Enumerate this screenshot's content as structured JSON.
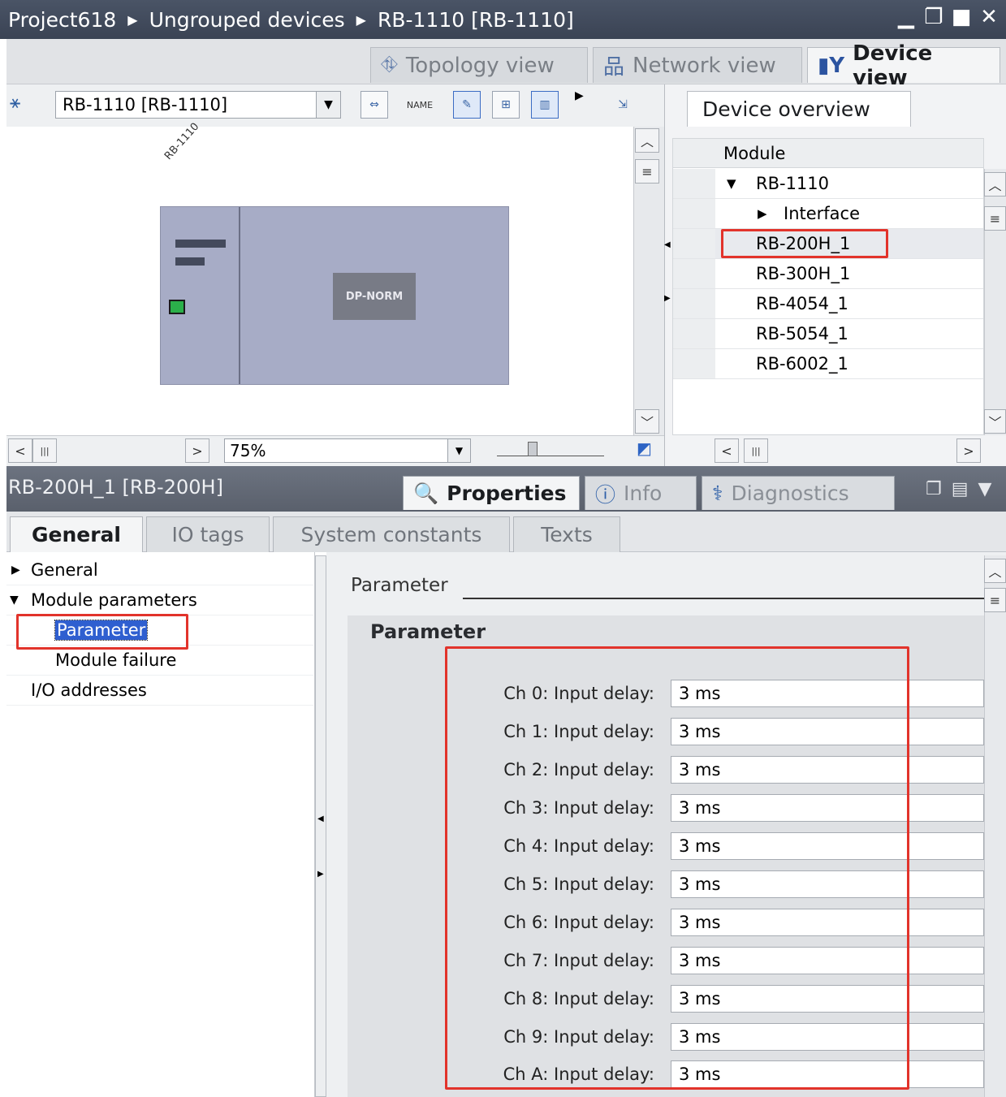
{
  "breadcrumb": [
    "Project618",
    "Ungrouped devices",
    "RB-1110 [RB-1110]"
  ],
  "view_tabs": [
    {
      "label": "Topology view",
      "active": false
    },
    {
      "label": "Network view",
      "active": false
    },
    {
      "label": "Device view",
      "active": true
    }
  ],
  "toolbar": {
    "device_select": "RB-1110 [RB-1110]",
    "zoom": "75%"
  },
  "device": {
    "rack_label": "RB-1110",
    "module_label": "DP-NORM"
  },
  "overview": {
    "tab": "Device overview",
    "column_header": "Module",
    "rows": [
      "RB-1110",
      "Interface",
      "RB-200H_1",
      "RB-300H_1",
      "RB-4054_1",
      "RB-5054_1",
      "RB-6002_1"
    ],
    "selected": "RB-200H_1"
  },
  "properties": {
    "title": "RB-200H_1 [RB-200H]",
    "tabs": [
      "Properties",
      "Info",
      "Diagnostics"
    ],
    "subtabs": [
      "General",
      "IO tags",
      "System constants",
      "Texts"
    ]
  },
  "nav": {
    "items": [
      "General",
      "Module parameters",
      "Parameter",
      "Module failure",
      "I/O addresses"
    ],
    "selected": "Parameter"
  },
  "params": {
    "heading": "Parameter",
    "group_title": "Parameter",
    "rows": [
      {
        "label": "Ch 0: Input delay:",
        "value": "3 ms"
      },
      {
        "label": "Ch 1: Input delay:",
        "value": "3 ms"
      },
      {
        "label": "Ch 2: Input delay:",
        "value": "3 ms"
      },
      {
        "label": "Ch 3: Input delay:",
        "value": "3 ms"
      },
      {
        "label": "Ch 4: Input delay:",
        "value": "3 ms"
      },
      {
        "label": "Ch 5: Input delay:",
        "value": "3 ms"
      },
      {
        "label": "Ch 6: Input delay:",
        "value": "3 ms"
      },
      {
        "label": "Ch 7: Input delay:",
        "value": "3 ms"
      },
      {
        "label": "Ch 8: Input delay:",
        "value": "3 ms"
      },
      {
        "label": "Ch 9: Input delay:",
        "value": "3 ms"
      },
      {
        "label": "Ch A: Input delay:",
        "value": "3 ms"
      }
    ]
  },
  "colors": {
    "titlebar": "#3f4858",
    "highlight": "#e2332b",
    "selection": "#2f5fd0"
  }
}
